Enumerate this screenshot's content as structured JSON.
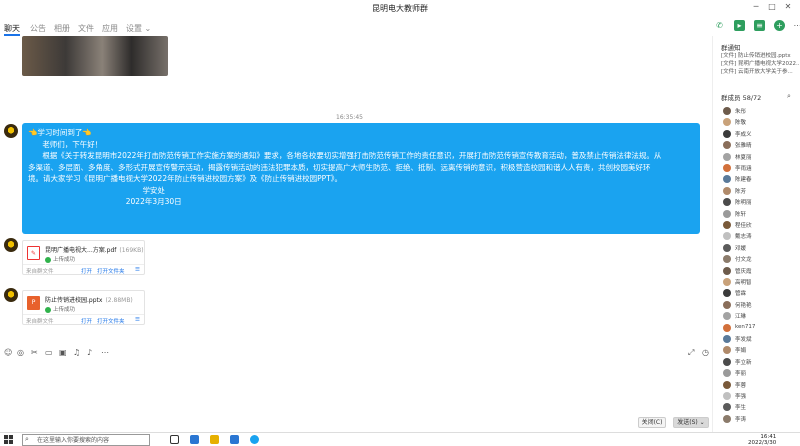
{
  "window": {
    "title": "昆明电大教师群"
  },
  "nav": {
    "tabs": [
      "聊天",
      "公告",
      "相册",
      "文件",
      "应用",
      "设置 ⌄"
    ]
  },
  "chat": {
    "timestamp": "16:35:45",
    "message_lines": [
      "👈学习时间到了👈",
      "      老师们，下午好！",
      "      根据《关于转发昆明市2022年打击防范传销工作实施方案的通知》要求，各地各校要切实增强打击防范传销工作的责任意识，开展打击防范传销宣传教育活动，普及禁止传销法律法规。从",
      "多渠道、多层面、多角度、多形式开展宣传警示活动，揭露传销活动的违法犯罪本质，切实提高广大师生防范、拒绝、抵制、远离传销的意识，积极营造校园和谐人人有责，共创校园美好环",
      "境。请大家学习《昆明广播电视大学2022年防止传销进校园方案》及《防止传销进校园PPT》。",
      "",
      "                                                学安处",
      "                                         2022年3月30日"
    ],
    "files": [
      {
        "name": "昆明广播电视大...方案.pdf",
        "size": "(169KB)",
        "status": "上传成功",
        "source": "来自群文件",
        "open": "打开",
        "open_folder": "打开文件夹",
        "type_label": "PDF"
      },
      {
        "name": "防止传销进校园.pptx",
        "size": "(2.88MB)",
        "status": "上传成功",
        "source": "来自群文件",
        "open": "打开",
        "open_folder": "打开文件夹",
        "type_label": "P"
      }
    ]
  },
  "buttons": {
    "close": "关闭(C)",
    "send": "发送(S) ⌄"
  },
  "sidebar": {
    "notice_title": "群通知",
    "notices": [
      "[文件] 防止传销进校园.pptx",
      "[文件] 昆明广播电视大学2022...",
      "[文件] 云南开放大学关于参..."
    ],
    "members_title": "群成员 58/72",
    "members": [
      {
        "name": "朱彤"
      },
      {
        "name": "陈敬"
      },
      {
        "name": "李成义"
      },
      {
        "name": "张雅晴"
      },
      {
        "name": "林夏丽"
      },
      {
        "name": "李雨涵"
      },
      {
        "name": "陈建春"
      },
      {
        "name": "陈芳"
      },
      {
        "name": "陈明丽"
      },
      {
        "name": "陈轩"
      },
      {
        "name": "程佳欣"
      },
      {
        "name": "戴志涛"
      },
      {
        "name": "邓媛"
      },
      {
        "name": "付文龙"
      },
      {
        "name": "管庆霞"
      },
      {
        "name": "高明智"
      },
      {
        "name": "管霖"
      },
      {
        "name": "何艳艳"
      },
      {
        "name": "江琳"
      },
      {
        "name": "ken717"
      },
      {
        "name": "李发斌"
      },
      {
        "name": "李娟"
      },
      {
        "name": "李立新"
      },
      {
        "name": "李丽"
      },
      {
        "name": "李蓉"
      },
      {
        "name": "李强"
      },
      {
        "name": "李生"
      },
      {
        "name": "李涛"
      }
    ]
  },
  "taskbar": {
    "search_placeholder": "在这里输入你要搜索的内容",
    "time": "16:41",
    "date": "2022/3/30"
  }
}
